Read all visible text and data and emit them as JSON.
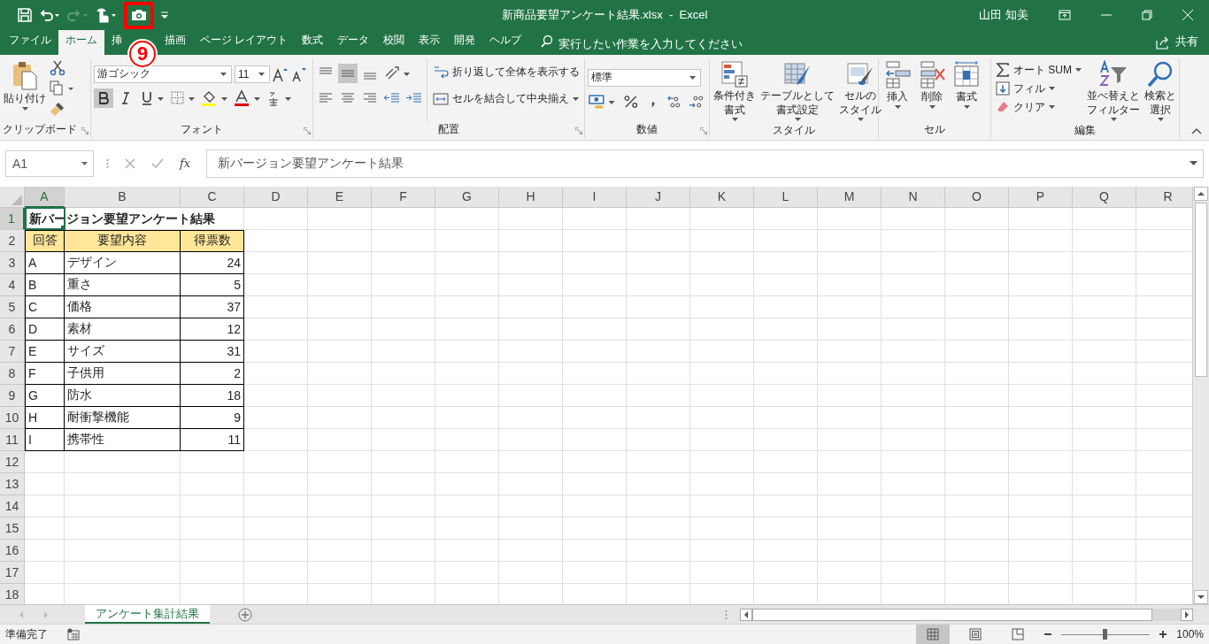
{
  "window": {
    "title": "新商品要望アンケート結果.xlsx  -  Excel",
    "user": "山田 知美"
  },
  "annotation": {
    "number": "9"
  },
  "ribbon_tabs": [
    {
      "label": "ファイル",
      "selected": false
    },
    {
      "label": "ホーム",
      "selected": true
    },
    {
      "label": "挿",
      "selected": false
    },
    {
      "label": "描画",
      "selected": false
    },
    {
      "label": "ページ レイアウト",
      "selected": false
    },
    {
      "label": "数式",
      "selected": false
    },
    {
      "label": "データ",
      "selected": false
    },
    {
      "label": "校閲",
      "selected": false
    },
    {
      "label": "表示",
      "selected": false
    },
    {
      "label": "開発",
      "selected": false
    },
    {
      "label": "ヘルプ",
      "selected": false
    }
  ],
  "tell_me": {
    "placeholder": "実行したい作業を入力してください"
  },
  "share": "共有",
  "clipboard": {
    "paste": "貼り付け",
    "label": "クリップボード"
  },
  "font": {
    "name": "游ゴシック",
    "size": "11",
    "label": "フォント",
    "bold_on": true
  },
  "alignment": {
    "wrap": "折り返して全体を表示する",
    "merge": "セルを結合して中央揃え",
    "label": "配置"
  },
  "number": {
    "format": "標準",
    "label": "数値"
  },
  "styles": {
    "buttons": [
      {
        "lines": [
          "条件付き",
          "書式"
        ]
      },
      {
        "lines": [
          "テーブルとして",
          "書式設定"
        ]
      },
      {
        "lines": [
          "セルの",
          "スタイル"
        ]
      }
    ],
    "label": "スタイル"
  },
  "cells": {
    "buttons": [
      "挿入",
      "削除",
      "書式"
    ],
    "label": "セル"
  },
  "editing": {
    "autosum": "オート SUM",
    "fill": "フィル",
    "clear": "クリア",
    "sort": [
      "並べ替えと",
      "フィルター"
    ],
    "find": [
      "検索と",
      "選択"
    ],
    "label": "編集"
  },
  "formula_bar": {
    "name_box": "A1",
    "fx": "fx",
    "content": "新バージョン要望アンケート結果"
  },
  "columns": [
    {
      "label": "A",
      "selected": true
    },
    {
      "label": "B",
      "selected": false
    },
    {
      "label": "C",
      "selected": false
    },
    {
      "label": "D",
      "selected": false
    },
    {
      "label": "E",
      "selected": false
    },
    {
      "label": "F",
      "selected": false
    },
    {
      "label": "G",
      "selected": false
    },
    {
      "label": "H",
      "selected": false
    },
    {
      "label": "I",
      "selected": false
    },
    {
      "label": "J",
      "selected": false
    },
    {
      "label": "K",
      "selected": false
    },
    {
      "label": "L",
      "selected": false
    },
    {
      "label": "M",
      "selected": false
    },
    {
      "label": "N",
      "selected": false
    },
    {
      "label": "O",
      "selected": false
    },
    {
      "label": "P",
      "selected": false
    },
    {
      "label": "Q",
      "selected": false
    },
    {
      "label": "R",
      "selected": false
    }
  ],
  "rows": [
    {
      "number": "1",
      "selected": true,
      "kind": "title",
      "cells": [
        "新バージョン要望アンケート結果"
      ]
    },
    {
      "number": "2",
      "selected": false,
      "kind": "header",
      "cells": [
        "回答",
        "要望内容",
        "得票数"
      ]
    },
    {
      "number": "3",
      "selected": false,
      "kind": "data",
      "cells": [
        "A",
        "デザイン",
        "24"
      ]
    },
    {
      "number": "4",
      "selected": false,
      "kind": "data",
      "cells": [
        "B",
        "重さ",
        "5"
      ]
    },
    {
      "number": "5",
      "selected": false,
      "kind": "data",
      "cells": [
        "C",
        "価格",
        "37"
      ]
    },
    {
      "number": "6",
      "selected": false,
      "kind": "data",
      "cells": [
        "D",
        "素材",
        "12"
      ]
    },
    {
      "number": "7",
      "selected": false,
      "kind": "data",
      "cells": [
        "E",
        "サイズ",
        "31"
      ]
    },
    {
      "number": "8",
      "selected": false,
      "kind": "data",
      "cells": [
        "F",
        "子供用",
        "2"
      ]
    },
    {
      "number": "9",
      "selected": false,
      "kind": "data",
      "cells": [
        "G",
        "防水",
        "18"
      ]
    },
    {
      "number": "10",
      "selected": false,
      "kind": "data",
      "cells": [
        "H",
        "耐衝撃機能",
        "9"
      ]
    },
    {
      "number": "11",
      "selected": false,
      "kind": "data",
      "cells": [
        "I",
        "携帯性",
        "11"
      ]
    },
    {
      "number": "12",
      "selected": false,
      "kind": "empty"
    },
    {
      "number": "13",
      "selected": false,
      "kind": "empty"
    },
    {
      "number": "14",
      "selected": false,
      "kind": "empty"
    },
    {
      "number": "15",
      "selected": false,
      "kind": "empty"
    },
    {
      "number": "16",
      "selected": false,
      "kind": "empty"
    },
    {
      "number": "17",
      "selected": false,
      "kind": "empty"
    },
    {
      "number": "18",
      "selected": false,
      "kind": "empty"
    }
  ],
  "sheet_tabs": [
    {
      "label": "アンケート集計結果",
      "selected": true
    }
  ],
  "status_bar": {
    "text": "準備完了",
    "views": [
      {
        "kind": "normal",
        "selected": true
      },
      {
        "kind": "page",
        "selected": false
      },
      {
        "kind": "break",
        "selected": false
      }
    ],
    "zoom": {
      "level": 0.5,
      "reading": "100%"
    }
  }
}
